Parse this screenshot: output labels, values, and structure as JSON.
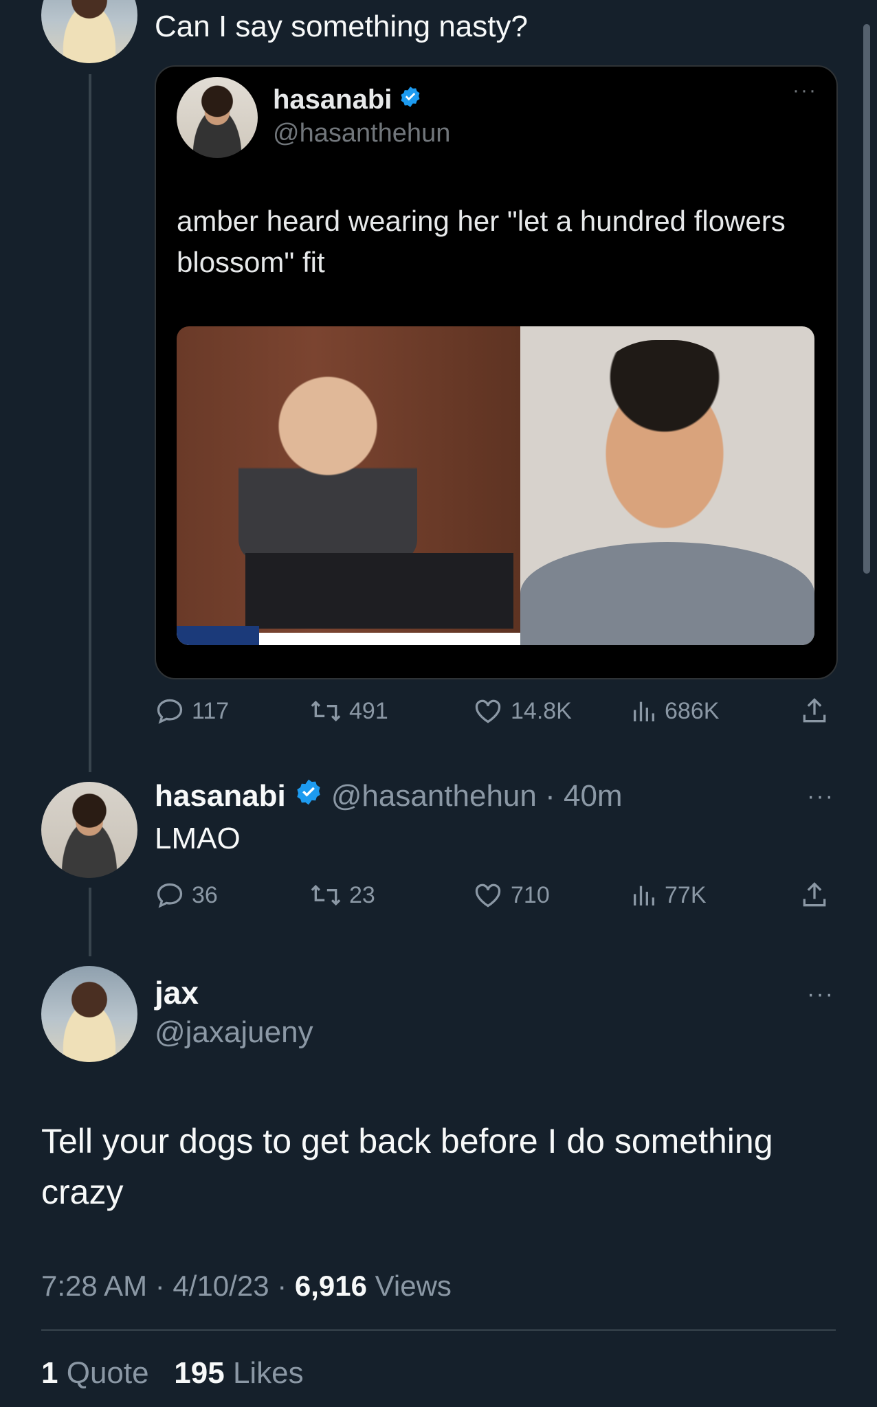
{
  "colors": {
    "background": "#15202b",
    "text_primary": "#f7f9f9",
    "text_secondary": "#8b98a5",
    "verified": "#1d9bf0",
    "divider": "#38444d"
  },
  "top_tweet": {
    "text": "Can I say something nasty?"
  },
  "quoted_tweet": {
    "name": "hasanabi",
    "handle": "@hasanthehun",
    "more": "···",
    "text": "amber heard wearing her \"let a hundred flowers blossom\" fit"
  },
  "top_actions": {
    "replies": "117",
    "retweets": "491",
    "likes": "14.8K",
    "views": "686K"
  },
  "reply_tweet": {
    "name": "hasanabi",
    "handle_time": "@hasanthehun · 40m",
    "text": "LMAO",
    "more": "···"
  },
  "reply_actions": {
    "replies": "36",
    "retweets": "23",
    "likes": "710",
    "views": "77K"
  },
  "main_tweet": {
    "name": "jax",
    "handle": "@jaxajueny",
    "more": "···",
    "text": "Tell your dogs to get back before I do something crazy",
    "time_date": "7:28 AM · 4/10/23 · ",
    "views_count": "6,916",
    "views_label": "Views",
    "quotes_count": "1",
    "quotes_label": "Quote",
    "likes_count": "195",
    "likes_label": "Likes"
  },
  "icons": {
    "reply": "reply-icon",
    "retweet": "retweet-icon",
    "like": "heart-icon",
    "views": "views-icon",
    "share": "share-icon",
    "verified": "verified-badge-icon"
  }
}
